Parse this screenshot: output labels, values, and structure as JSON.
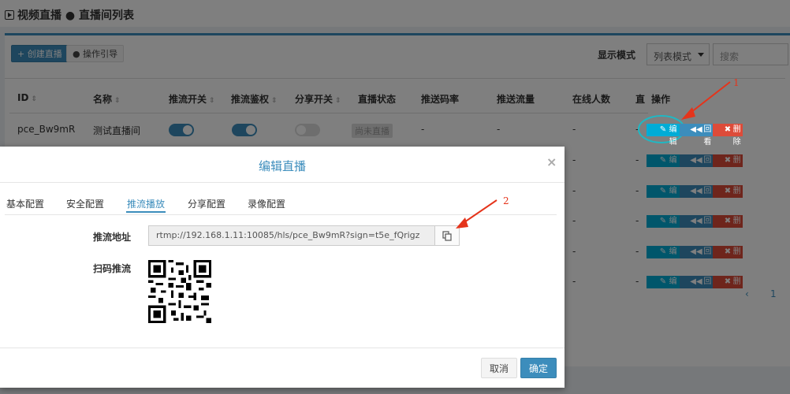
{
  "header": {
    "title": "视频直播 ● 直播间列表"
  },
  "toolbar": {
    "create_label": "创建直播",
    "guide_label": "操作引导",
    "display_mode_label": "显示模式",
    "display_mode_value": "列表模式",
    "search_placeholder": "搜索"
  },
  "table": {
    "columns": [
      "ID",
      "名称",
      "推流开关",
      "推流鉴权",
      "分享开关",
      "直播状态",
      "推送码率",
      "推送流量",
      "在线人数",
      "直",
      "操作"
    ],
    "first_row": {
      "id": "pce_Bw9mR",
      "name": "测试直播间",
      "push_switch": true,
      "push_auth": true,
      "share_switch": false,
      "status": "尚未直播",
      "bitrate": "-",
      "traffic": "-",
      "online": "-",
      "extra": "-"
    },
    "row_dash": "-",
    "actions": {
      "edit": "编辑",
      "playback": "回看",
      "delete": "删除"
    }
  },
  "pagination": {
    "prev": "‹",
    "page": "1"
  },
  "modal": {
    "title": "编辑直播",
    "close": "×",
    "tabs": [
      "基本配置",
      "安全配置",
      "推流播放",
      "分享配置",
      "录像配置"
    ],
    "active_tab": 2,
    "push_url_label": "推流地址",
    "push_url_value": "rtmp://192.168.1.11:10085/hls/pce_Bw9mR?sign=t5e_fQrigz",
    "qr_label": "扫码推流",
    "cancel_label": "取消",
    "ok_label": "确定"
  },
  "annotations": {
    "step1": "1",
    "step2": "2"
  },
  "colors": {
    "accent": "#3c8dbc",
    "edit": "#00acd6",
    "delete": "#dd4b39",
    "arrow": "#e5341b"
  },
  "icons": [
    "play-icon",
    "plus-icon",
    "info-icon",
    "sort-icon",
    "copy-icon",
    "edit-icon",
    "rewind-icon",
    "times-icon",
    "qr-code-icon"
  ]
}
